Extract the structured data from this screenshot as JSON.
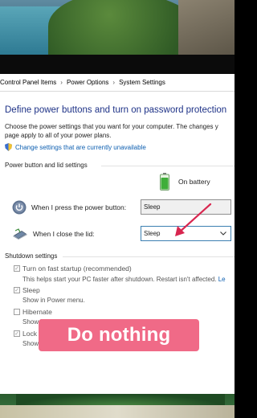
{
  "breadcrumb": [
    "Control Panel Items",
    "Power Options",
    "System Settings"
  ],
  "page": {
    "heading": "Define power buttons and turn on password protection",
    "description_line1": "Choose the power settings that you want for your computer. The changes y",
    "description_line2": "page apply to all of your power plans.",
    "change_settings_link": "Change settings that are currently unavailable"
  },
  "power_group": {
    "title": "Power button and lid settings",
    "column_header": "On battery",
    "rows": [
      {
        "label": "When I press the power button:",
        "value": "Sleep"
      },
      {
        "label": "When I close the lid:",
        "value": "Sleep"
      }
    ]
  },
  "shutdown_group": {
    "title": "Shutdown settings",
    "items": [
      {
        "label": "Turn on fast startup (recommended)",
        "checked": true,
        "desc": "This helps start your PC faster after shutdown. Restart isn't affected.",
        "link": "Le"
      },
      {
        "label": "Sleep",
        "checked": true,
        "desc": "Show in Power menu."
      },
      {
        "label": "Hibernate",
        "checked": false,
        "desc": "Show in Power menu."
      },
      {
        "label": "Lock",
        "checked": true,
        "desc": "Show in account picture menu."
      }
    ]
  },
  "overlay_caption": "Do nothing",
  "colors": {
    "heading": "#1e3287",
    "link": "#0c5eb0",
    "caption_bg": "#f06a87",
    "arrow": "#d8264f",
    "battery": "#3fae3a"
  },
  "icons": [
    "shield-icon",
    "battery-icon",
    "power-button-icon",
    "laptop-lid-icon",
    "chevron-down-icon",
    "arrow-annotation"
  ]
}
